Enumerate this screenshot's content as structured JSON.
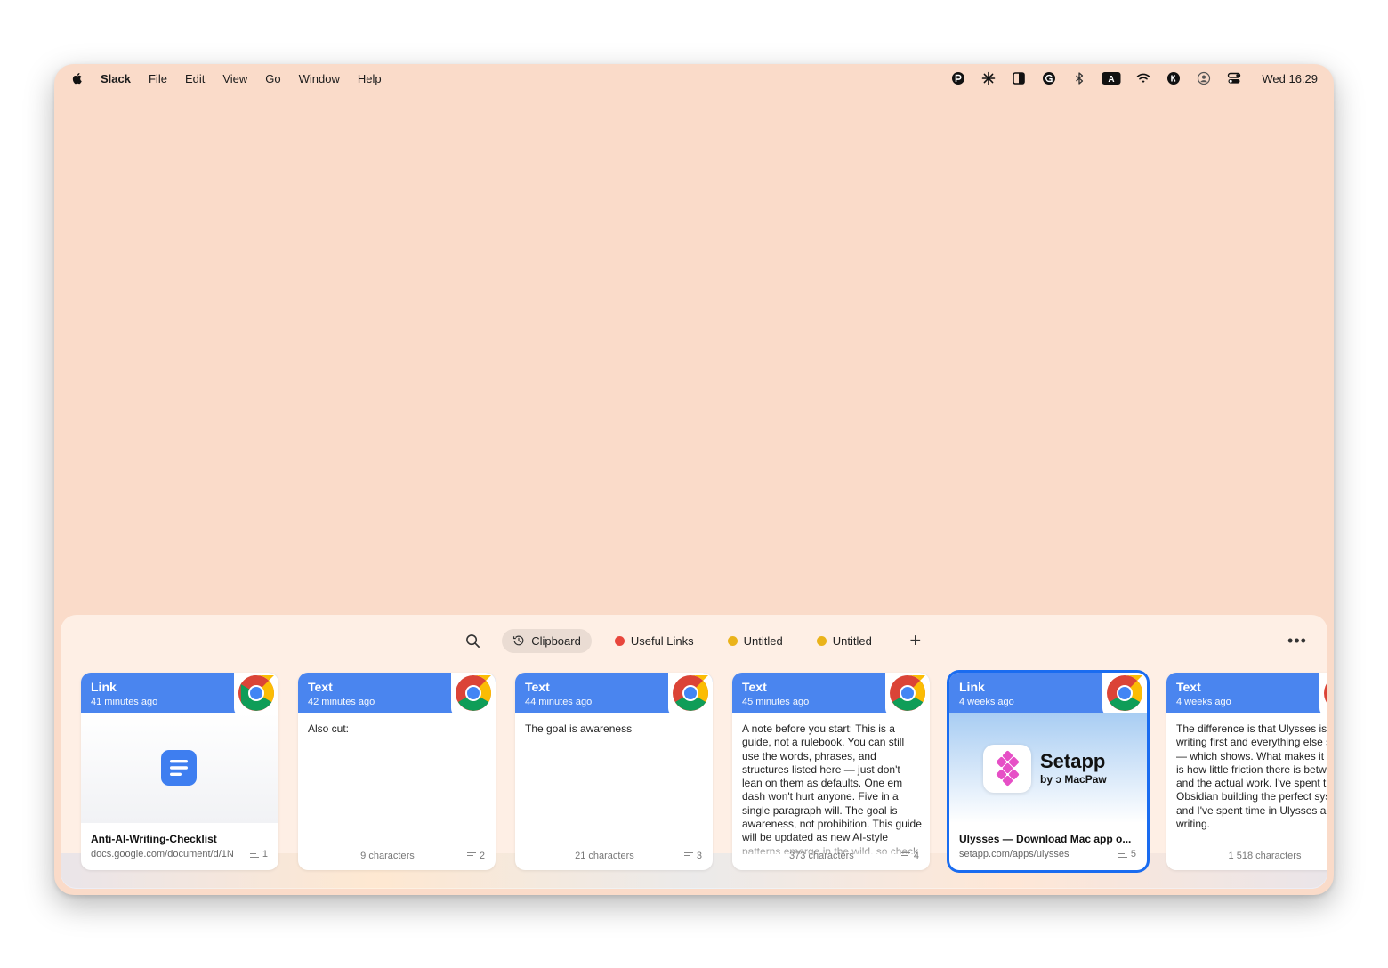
{
  "menubar": {
    "app_name": "Slack",
    "menus": [
      "File",
      "Edit",
      "View",
      "Go",
      "Window",
      "Help"
    ],
    "status_icons": [
      "pasta-icon",
      "sparkle-icon",
      "sidebar-icon",
      "grammarly-icon",
      "bluetooth-icon",
      "input-source-icon",
      "wifi-icon",
      "app-k-icon",
      "user-icon",
      "control-center-icon"
    ],
    "input_source_label": "A",
    "clock": "Wed 16:29"
  },
  "toolbar": {
    "tabs": [
      {
        "label": "Clipboard",
        "icon": "history-icon",
        "active": true
      },
      {
        "label": "Useful Links",
        "color": "#e8463c"
      },
      {
        "label": "Untitled",
        "color": "#eab31a"
      },
      {
        "label": "Untitled",
        "color": "#eab31a"
      }
    ],
    "more_label": "•••",
    "add_label": "+"
  },
  "cards": [
    {
      "type": "Link",
      "time": "41 minutes ago",
      "title": "Anti-AI-Writing-Checklist",
      "url": "docs.google.com/document/d/1N",
      "index": "1"
    },
    {
      "type": "Text",
      "time": "42 minutes ago",
      "text": "Also cut:",
      "chars": "9 characters",
      "index": "2"
    },
    {
      "type": "Text",
      "time": "44 minutes ago",
      "text": "The goal is awareness",
      "chars": "21 characters",
      "index": "3"
    },
    {
      "type": "Text",
      "time": "45 minutes ago",
      "text": "A note before you start: This is a guide, not a rulebook. You can still use the words, phrases, and structures listed here — just don't lean on them as defaults. One em dash won't hurt anyone. Five in a single paragraph will. The goal is awareness, not prohibition. This guide will be updated as new AI-style patterns emerge in the wild, so check back.",
      "chars": "373 characters",
      "index": "4"
    },
    {
      "type": "Link",
      "time": "4 weeks ago",
      "title": "Ulysses — Download Mac app o...",
      "url": "setapp.com/apps/ulysses",
      "index": "5",
      "preview_brand": "Setapp",
      "preview_sub": "by ↄ MacPaw",
      "selected": true
    },
    {
      "type": "Text",
      "time": "4 weeks ago",
      "text": "The difference is that Ulysses is built for writing first and everything else second — which shows. What makes it stand out is how little friction there is between you and the actual work. I've spent time in Obsidian building the perfect system, and I've spent time in Ulysses actually writing.",
      "chars": "1 518 characters"
    }
  ]
}
